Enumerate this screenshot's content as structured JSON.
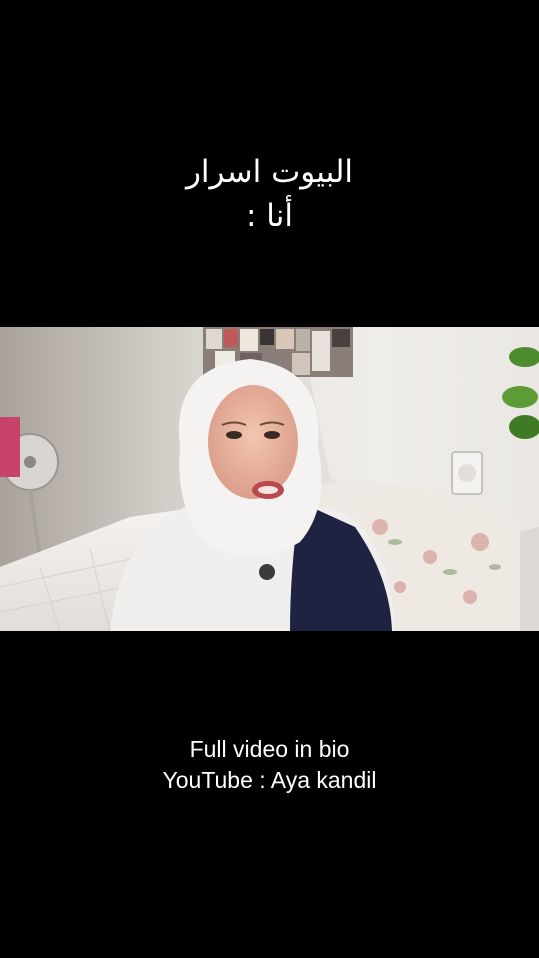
{
  "overlay_top": {
    "line1": "البيوت اسرار",
    "line2": "أنا :"
  },
  "overlay_bottom": {
    "line1": "Full video in bio",
    "line2": "YouTube : Aya kandil"
  },
  "colors": {
    "background": "#000000",
    "text": "#ffffff"
  }
}
